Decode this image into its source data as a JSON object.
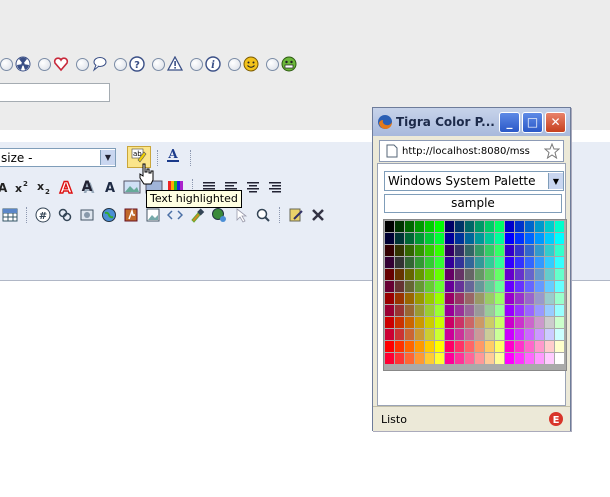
{
  "editor": {
    "font_size_value": "size -",
    "tooltip": "Text highlighted"
  },
  "popup": {
    "title": "Tigra Color P...",
    "url": "http://localhost:8080/mss",
    "palette_value": "Windows System Palette",
    "sample_text": "sample",
    "status": "Listo"
  },
  "emoticon_icons": [
    "radioactive-icon",
    "heart-icon",
    "speech-bubble-icon",
    "question-icon",
    "warning-icon",
    "info-icon",
    "smiley-icon",
    "grin-icon"
  ],
  "colors": {
    "titlebar": "#a8b9dc",
    "highlight": "#fbe58a",
    "tooltip_bg": "#ffffe1"
  }
}
